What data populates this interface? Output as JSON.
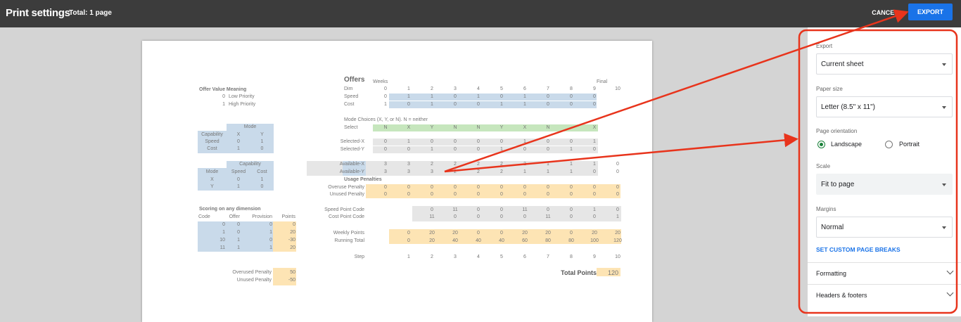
{
  "header": {
    "title": "Print settings",
    "total": "Total: 1 page",
    "cancel_label": "CANCEL",
    "export_label": "EXPORT"
  },
  "panel": {
    "export_label": "Export",
    "export_value": "Current sheet",
    "paper_label": "Paper size",
    "paper_value": "Letter (8.5\" x 11\")",
    "orientation_label": "Page orientation",
    "landscape": "Landscape",
    "portrait": "Portrait",
    "selected_orientation": "Landscape",
    "scale_label": "Scale",
    "scale_value": "Fit to page",
    "margins_label": "Margins",
    "margins_value": "Normal",
    "custom_breaks": "SET CUSTOM PAGE BREAKS",
    "formatting": "Formatting",
    "headers_footers": "Headers & footers",
    "highlight_color": "#e8341c"
  },
  "sheet": {
    "ovm": {
      "title": "Offer Value Meaning",
      "rows": [
        [
          "0",
          "Low Priority"
        ],
        [
          "1",
          "High Priority"
        ]
      ]
    },
    "mode_table": {
      "header": "Mode",
      "cols": [
        "Capability",
        "X",
        "Y"
      ],
      "rows": [
        [
          "Speed",
          "0",
          "1"
        ],
        [
          "Cost",
          "1",
          "0"
        ]
      ]
    },
    "cap_table": {
      "header": "Capability",
      "cols": [
        "Mode",
        "Speed",
        "Cost"
      ],
      "rows": [
        [
          "X",
          "0",
          "1"
        ],
        [
          "Y",
          "1",
          "0"
        ]
      ]
    },
    "scoring": {
      "title": "Scoring on any dimension",
      "cols": [
        "Code",
        "Offer",
        "Provision",
        "Points"
      ],
      "rows": [
        [
          "0",
          "0",
          "0",
          "0"
        ],
        [
          "1",
          "0",
          "1",
          "20"
        ],
        [
          "10",
          "1",
          "0",
          "-30"
        ],
        [
          "11",
          "1",
          "1",
          "20"
        ]
      ]
    },
    "penalties": [
      {
        "label": "Overused Penalty",
        "value": "50"
      },
      {
        "label": "Unused Penalty",
        "value": "-50"
      }
    ],
    "offers_title": "Offers",
    "weeks_label": "Weeks",
    "final_label": "Final",
    "dim_label": "Dim",
    "dims": [
      "0",
      "1",
      "2",
      "3",
      "4",
      "5",
      "6",
      "7",
      "8",
      "9",
      "10"
    ],
    "speed": {
      "label": "Speed",
      "values": [
        "0",
        "1",
        "1",
        "0",
        "1",
        "0",
        "1",
        "0",
        "0",
        "0"
      ]
    },
    "cost": {
      "label": "Cost",
      "values": [
        "1",
        "0",
        "1",
        "0",
        "0",
        "1",
        "1",
        "0",
        "0",
        "0"
      ]
    },
    "mode_note": "Mode Choices (X, Y, or N). N = neither",
    "select": {
      "label": "Select",
      "values": [
        "N",
        "X",
        "Y",
        "N",
        "N",
        "Y",
        "X",
        "N",
        "",
        "X"
      ]
    },
    "selx": {
      "label": "Selected-X",
      "values": [
        "0",
        "1",
        "0",
        "0",
        "0",
        "0",
        "1",
        "0",
        "0",
        "1"
      ]
    },
    "sely": {
      "label": "Selected-Y",
      "values": [
        "0",
        "0",
        "1",
        "0",
        "0",
        "1",
        "0",
        "0",
        "1",
        "0"
      ]
    },
    "avx": {
      "label": "Available-X",
      "values": [
        "3",
        "3",
        "2",
        "2",
        "2",
        "2",
        "2",
        "1",
        "1",
        "1",
        "0"
      ]
    },
    "avy": {
      "label": "Available-Y",
      "values": [
        "3",
        "3",
        "3",
        "2",
        "2",
        "2",
        "1",
        "1",
        "1",
        "0",
        "0"
      ]
    },
    "usage_title": "Usage Penalties",
    "overuse": {
      "label": "Overuse Penalty",
      "values": [
        "0",
        "0",
        "0",
        "0",
        "0",
        "0",
        "0",
        "0",
        "0",
        "0",
        "0"
      ]
    },
    "unused": {
      "label": "Unused Penalty",
      "values": [
        "0",
        "0",
        "0",
        "0",
        "0",
        "0",
        "0",
        "0",
        "0",
        "0",
        "0"
      ]
    },
    "spc": {
      "label": "Speed Point Code",
      "values": [
        "0",
        "11",
        "0",
        "0",
        "11",
        "0",
        "0",
        "1",
        "0"
      ]
    },
    "cpc": {
      "label": "Cost Point Code",
      "values": [
        "11",
        "0",
        "0",
        "0",
        "0",
        "11",
        "0",
        "0",
        "1"
      ]
    },
    "weekly": {
      "label": "Weekly Points",
      "values": [
        "0",
        "20",
        "20",
        "0",
        "0",
        "20",
        "20",
        "0",
        "20",
        "20"
      ]
    },
    "running": {
      "label": "Running Total",
      "values": [
        "0",
        "20",
        "40",
        "40",
        "40",
        "60",
        "80",
        "80",
        "100",
        "120"
      ]
    },
    "step": {
      "label": "Step",
      "values": [
        "1",
        "2",
        "3",
        "4",
        "5",
        "6",
        "7",
        "8",
        "9",
        "10"
      ]
    },
    "total_points_label": "Total Points",
    "total_points": "120"
  }
}
